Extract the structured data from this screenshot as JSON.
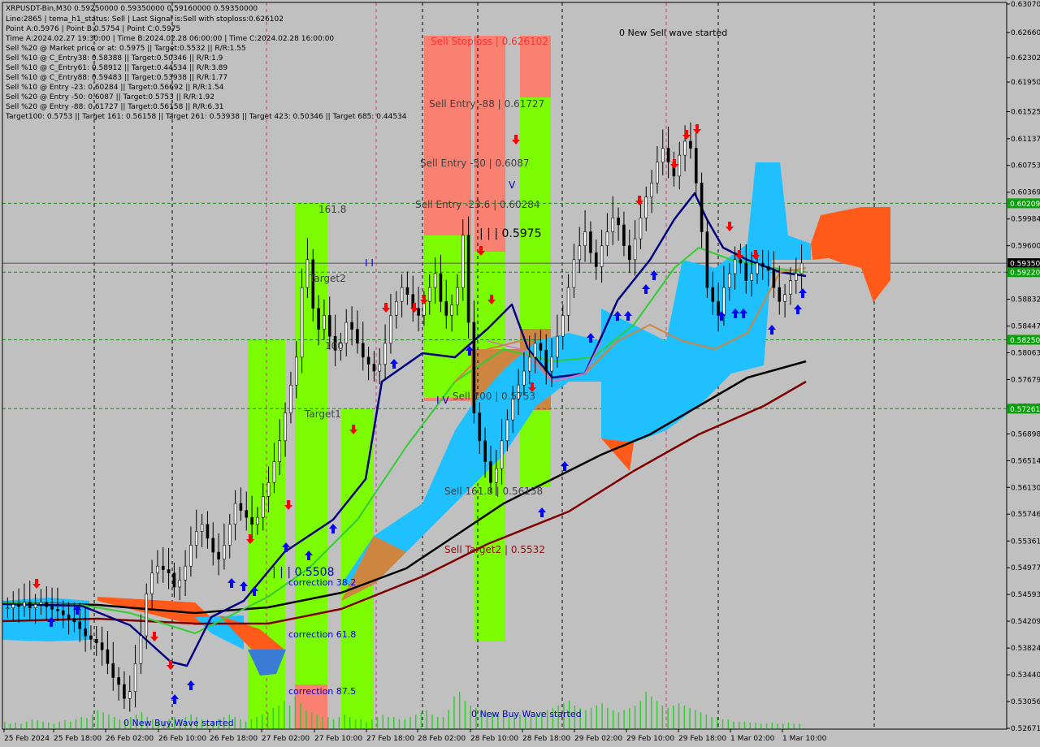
{
  "colors": {
    "background": "#c0c0c0",
    "frame": "#000000",
    "grid": "#000000",
    "bull_body": "#000000",
    "ma_fast": "#000080",
    "ma_mid": "#32cd32",
    "ma_slow_black": "#000000",
    "ma_slow_red": "#800000",
    "cloud_blue": "#1ec0ff",
    "cloud_orange": "#ff5a1a",
    "zone_green": "#7cfc00",
    "zone_red": "#fa8072",
    "zone_brown": "#cd853f",
    "buy_arrow": "#0000ff",
    "sell_arrow": "#ff0000",
    "volume": "#32cd32",
    "current_price_bg": "#000000",
    "level_green_bg": "#0aa00a"
  },
  "header": {
    "lines": [
      "XRPUSDT-Bin,M30  0.59250000 0.59350000 0.59160000 0.59350000",
      "Line:2865 | tema_h1_status: Sell | Last Signal is:Sell with stoploss:0.626102",
      "Point A:0.5976 | Point B:0.5754 | Point C:0.5975",
      "Time A:2024.02.27 19:30:00 | Time B:2024.02.28 06:00:00 | Time C:2024.02.28 16:00:00",
      "Sell %20 @ Market price or at: 0.5975 || Target:0.5532 || R/R:1.55",
      "Sell %10 @ C_Entry38: 0.58388 || Target:0.50346 || R/R:1.9",
      "Sell %10 @ C_Entry61: 0.58912 || Target:0.44534 || R/R:3.89",
      "Sell %10 @ C_Entry88: 0.59483 || Target:0.53938 || R/R:1.77",
      "Sell %10 @ Entry -23: 0.60284 || Target:0.56692 || R/R:1.54",
      "Sell %20 @ Entry -50: 0.6087 || Target:0.5753 || R/R:1.92",
      "Sell %20 @ Entry -88: 0.61727 || Target:0.56158 || R/R:6.31",
      "Target100: 0.5753 || Target 161: 0.56158 || Target 261: 0.53938 || Target 423: 0.50346 || Target 685: 0.44534"
    ]
  },
  "chart_labels": {
    "sell_stoploss": "Sell Stoploss | 0.626102",
    "sell_entry_88": "Sell Entry -88 | 0.61727",
    "sell_entry_50": "Sell Entry -50 | 0.6087",
    "sell_entry_23": "Sell Entry -23.6 | 0.60284",
    "c_value": "| | | 0.5975",
    "sell_100": "Sell 100 | 0.5753",
    "sell_161": "Sell 161.8 | 0.56158",
    "sell_target2": "Sell Target2 | 0.5532",
    "buy_1618": "161.8",
    "buy_target2": "Target2",
    "buy_100": "100",
    "buy_target1": "Target1",
    "buy_value": "| | | 0.5508",
    "corr_382": "correction 38.2",
    "corr_618": "correction 61.8",
    "corr_875": "correction 87.5",
    "wave_sell": "0 New Sell wave started",
    "wave_buy1": "0 New Buy Wave started",
    "wave_buy2": "0 New Buy Wave started",
    "pt_iv": "I V",
    "pt_v": "V",
    "pt_ii": "I I"
  },
  "chart_data": {
    "type": "candlestick",
    "symbol": "XRPUSDT-Bin",
    "timeframe": "M30",
    "ylim": [
      0.52671,
      0.6307
    ],
    "y_ticks": [
      "0.63070",
      "0.62660",
      "0.62302",
      "0.61950",
      "0.61525",
      "0.61137",
      "0.60753",
      "0.60369",
      "0.59984",
      "0.59600",
      "0.59216",
      "0.58832",
      "0.58447",
      "0.58063",
      "0.57679",
      "0.57295",
      "0.56898",
      "0.56514",
      "0.56130",
      "0.55746",
      "0.55361",
      "0.54977",
      "0.54593",
      "0.54209",
      "0.53824",
      "0.53440",
      "0.53056",
      "0.52671"
    ],
    "x_ticks": [
      "25 Feb 2024",
      "25 Feb 18:00",
      "26 Feb 02:00",
      "26 Feb 10:00",
      "26 Feb 18:00",
      "27 Feb 02:00",
      "27 Feb 10:00",
      "27 Feb 18:00",
      "28 Feb 02:00",
      "28 Feb 10:00",
      "28 Feb 18:00",
      "29 Feb 02:00",
      "29 Feb 10:00",
      "29 Feb 18:00",
      "1 Mar 02:00",
      "1 Mar 10:00"
    ],
    "price_labels": [
      {
        "value": "0.60209",
        "price": 0.60209,
        "style": "green"
      },
      {
        "value": "0.59350",
        "price": 0.5935,
        "style": "current"
      },
      {
        "value": "0.59220",
        "price": 0.5922,
        "style": "green"
      },
      {
        "value": "0.58250",
        "price": 0.5825,
        "style": "green"
      },
      {
        "value": "0.57261",
        "price": 0.57261,
        "style": "green"
      }
    ],
    "hlines": [
      0.60209,
      0.5935,
      0.5922,
      0.5825,
      0.57261
    ],
    "last": {
      "open": 0.5925,
      "high": 0.5935,
      "low": 0.5916,
      "close": 0.5935
    },
    "candles_approx": [
      0.544,
      0.5445,
      0.5442,
      0.5448,
      0.544,
      0.5445,
      0.5448,
      0.5442,
      0.5438,
      0.5436,
      0.543,
      0.5425,
      0.542,
      0.541,
      0.54,
      0.5395,
      0.539,
      0.538,
      0.536,
      0.534,
      0.533,
      0.531,
      0.532,
      0.536,
      0.54,
      0.546,
      0.549,
      0.55,
      0.5495,
      0.549,
      0.547,
      0.548,
      0.55,
      0.553,
      0.555,
      0.556,
      0.554,
      0.552,
      0.551,
      0.553,
      0.556,
      0.559,
      0.558,
      0.557,
      0.556,
      0.557,
      0.56,
      0.562,
      0.565,
      0.568,
      0.572,
      0.576,
      0.58,
      0.59,
      0.594,
      0.587,
      0.584,
      0.586,
      0.583,
      0.581,
      0.582,
      0.585,
      0.584,
      0.582,
      0.58,
      0.579,
      0.578,
      0.579,
      0.582,
      0.586,
      0.588,
      0.59,
      0.589,
      0.587,
      0.586,
      0.588,
      0.59,
      0.592,
      0.588,
      0.586,
      0.5875,
      0.59,
      0.5975,
      0.585,
      0.572,
      0.568,
      0.565,
      0.562,
      0.564,
      0.568,
      0.571,
      0.574,
      0.576,
      0.578,
      0.58,
      0.582,
      0.581,
      0.578,
      0.58,
      0.583,
      0.586,
      0.59,
      0.594,
      0.596,
      0.598,
      0.595,
      0.593,
      0.596,
      0.598,
      0.6,
      0.599,
      0.596,
      0.594,
      0.597,
      0.6,
      0.603,
      0.605,
      0.608,
      0.61,
      0.608,
      0.606,
      0.609,
      0.611,
      0.61,
      0.605,
      0.598,
      0.59,
      0.588,
      0.586,
      0.59,
      0.592,
      0.594,
      0.5935,
      0.591,
      0.592,
      0.5935,
      0.593,
      0.5925,
      0.59,
      0.588,
      0.589,
      0.591,
      0.592,
      0.5935
    ],
    "volume_scale": [
      0.3,
      0.2,
      0.25,
      0.2,
      0.3,
      0.4,
      0.35,
      0.3,
      0.25,
      0.2,
      0.3,
      0.35,
      0.3,
      0.4,
      0.5,
      0.45,
      0.6,
      0.8,
      0.7,
      0.6,
      0.5,
      0.4,
      0.3,
      0.5,
      0.6,
      0.7,
      0.5,
      0.4,
      0.3,
      0.3,
      0.4,
      0.5,
      0.4,
      0.5,
      0.6,
      0.5,
      0.4,
      0.3,
      0.3,
      0.4,
      0.5,
      0.6,
      0.5,
      0.4,
      0.3,
      0.4,
      0.5,
      0.6,
      0.7,
      0.9,
      1,
      1.2,
      1.0,
      1.4,
      1.1,
      0.8,
      0.7,
      0.6,
      0.5,
      0.5,
      0.4,
      0.5,
      0.6,
      0.5,
      0.4,
      0.4,
      0.3,
      0.4,
      0.5,
      0.6,
      0.5,
      0.5,
      0.4,
      0.4,
      0.5,
      0.6,
      0.7,
      0.8,
      0.6,
      0.5,
      0.5,
      0.8,
      1.4,
      1.6,
      1.2,
      1.0,
      0.9,
      0.8,
      0.7,
      0.7,
      0.6,
      0.6,
      0.5,
      0.6,
      0.6,
      0.5,
      0.5,
      0.6,
      0.7,
      0.8,
      0.9,
      1.0,
      1.1,
      1.2,
      1.0,
      0.9,
      0.8,
      0.9,
      1.0,
      1.1,
      0.9,
      0.8,
      0.7,
      0.8,
      0.9,
      1.0,
      1.2,
      1.6,
      1.4,
      1.2,
      1.0,
      0.9,
      1.0,
      1.1,
      1.0,
      0.9,
      0.8,
      0.7,
      0.6,
      0.5,
      0.5,
      0.4,
      0.4,
      0.3,
      0.3,
      0.3,
      0.25,
      0.25,
      0.2,
      0.2,
      0.25,
      0.2,
      0.2,
      0.25,
      0.2,
      0.2
    ]
  }
}
